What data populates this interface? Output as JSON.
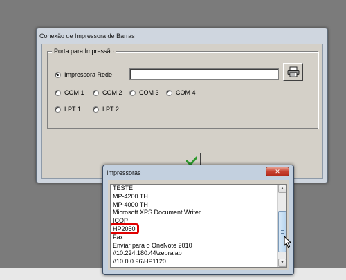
{
  "main_window": {
    "title": "Conexão de Impressora de Barras",
    "group_label": "Porta para Impressão",
    "rede_radio": {
      "label": "Impressora Rede",
      "checked": true
    },
    "rede_input_value": "",
    "com_ports": [
      "COM 1",
      "COM 2",
      "COM 3",
      "COM 4"
    ],
    "lpt_ports": [
      "LPT 1",
      "LPT 2"
    ],
    "printer_button_icon": "printer-icon",
    "ok_button_icon": "checkmark-icon"
  },
  "popup": {
    "title": "Impressoras",
    "close_icon": "close-icon",
    "items": [
      "TESTE",
      "MP-4200 TH",
      "MP-4000 TH",
      "Microsoft XPS Document Writer",
      "ICOP",
      "HP2050",
      "Fax",
      "Enviar para o OneNote 2010",
      "\\\\10.224.180.44\\zebralab",
      "\\\\10.0.0.96\\HP1120"
    ],
    "highlighted_item": "HP2050"
  },
  "colors": {
    "highlight": "#e00000",
    "ok_check": "#2e9a2e",
    "close_button": "#c74232"
  }
}
